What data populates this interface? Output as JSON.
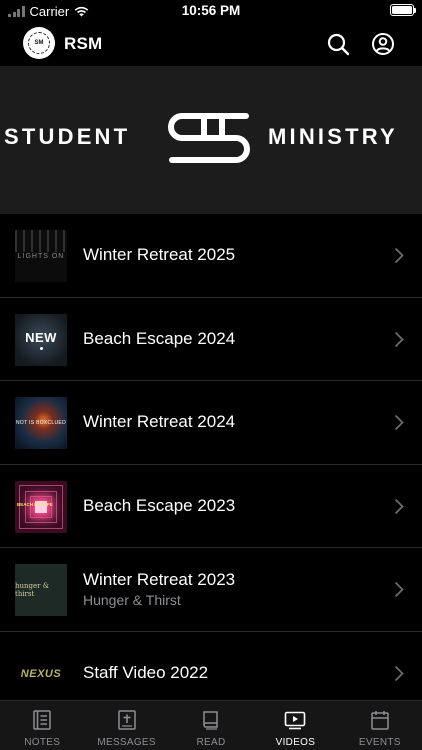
{
  "status_bar": {
    "carrier": "Carrier",
    "time": "10:56 PM"
  },
  "header": {
    "title": "RSM",
    "logo_text": "SM",
    "search_icon": "search-icon",
    "profile_icon": "profile-icon"
  },
  "banner": {
    "left_word": "STUDENT",
    "right_word": "MINISTRY"
  },
  "videos": [
    {
      "title": "Winter Retreat 2025",
      "subtitle": "",
      "thumb_text": "LIGHTS ON"
    },
    {
      "title": "Beach Escape 2024",
      "subtitle": "",
      "thumb_text": "NEW"
    },
    {
      "title": "Winter Retreat 2024",
      "subtitle": "",
      "thumb_text": "NOT IS BOXCLUED"
    },
    {
      "title": "Beach Escape 2023",
      "subtitle": "",
      "thumb_text": "BEACH ESCAPE"
    },
    {
      "title": "Winter Retreat 2023",
      "subtitle": "Hunger & Thirst",
      "thumb_text": "hunger & thirst"
    },
    {
      "title": "Staff Video 2022",
      "subtitle": "",
      "thumb_text": "NEXUS"
    }
  ],
  "tabs": [
    {
      "label": "NOTES",
      "icon": "notes-icon",
      "active": false
    },
    {
      "label": "MESSAGES",
      "icon": "messages-icon",
      "active": false
    },
    {
      "label": "READ",
      "icon": "read-icon",
      "active": false
    },
    {
      "label": "VIDEOS",
      "icon": "videos-icon",
      "active": true
    },
    {
      "label": "EVENTS",
      "icon": "events-icon",
      "active": false
    }
  ],
  "colors": {
    "background": "#000000",
    "banner": "#1c1c1c",
    "tab_bar": "#161616",
    "inactive_tab": "#8e8e93",
    "active_tab": "#ffffff",
    "separator": "#2c2c2e"
  }
}
